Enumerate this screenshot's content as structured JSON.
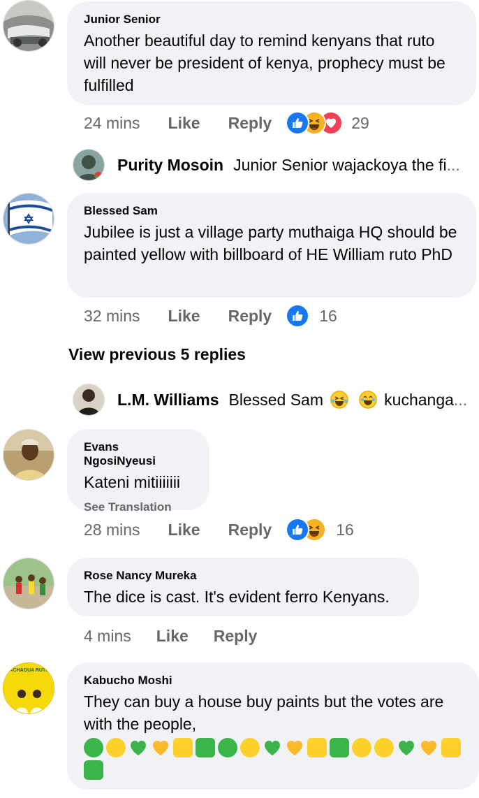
{
  "comments": [
    {
      "author": "Junior Senior",
      "text": "Another beautiful day to remind kenyans that ruto will never be president of kenya, prophecy must be fulfilled",
      "time": "24 mins",
      "like": "Like",
      "reply": "Reply",
      "reactions": [
        "like-icon",
        "haha-icon",
        "love-icon"
      ],
      "reaction_count": "29"
    },
    {
      "author": "Blessed Sam",
      "text": "Jubilee is just a village party muthaiga HQ should be painted yellow with billboard of HE William ruto PhD",
      "time": "32 mins",
      "like": "Like",
      "reply": "Reply",
      "reactions": [
        "like-icon"
      ],
      "reaction_count": "16"
    },
    {
      "author": "Evans NgosiNyeusi",
      "text": "Kateni mitiiiiiii",
      "see_translation": "See Translation",
      "time": "28 mins",
      "like": "Like",
      "reply": "Reply",
      "reactions": [
        "like-icon",
        "haha-icon"
      ],
      "reaction_count": "16"
    },
    {
      "author": "Rose Nancy Mureka",
      "text": "The dice is cast. It's evident ferro Kenyans.",
      "time": "4 mins",
      "like": "Like",
      "reply": "Reply"
    },
    {
      "author": "Kabucho Moshi",
      "text": "They can buy a house buy paints but the votes are with the people,",
      "emoji_sequence": [
        "green-circle",
        "yellow-circle",
        "green-heart",
        "yellow-heart",
        "yellow-square",
        "green-square",
        "green-circle",
        "yellow-circle",
        "green-heart",
        "yellow-heart",
        "yellow-square",
        "green-square",
        "yellow-circle",
        "yellow-circle",
        "green-heart",
        "yellow-heart",
        "yellow-square",
        "green-square"
      ]
    }
  ],
  "replies": [
    {
      "name": "Purity Mosoin",
      "text": "Junior Senior wajackoya the fi",
      "ellipsis": "..."
    },
    {
      "name": "L.M. Williams",
      "text_before": "Blessed Sam",
      "emojis": [
        "rofl-emoji",
        "joy-emoji"
      ],
      "text_after": "kuchanga",
      "ellipsis": "..."
    }
  ],
  "view_previous": "View previous 5 replies",
  "avatars": {
    "kabucho_badge": "ACHAGUA RUTO"
  },
  "colors": {
    "bubble": "#f0f2f5",
    "meta_text": "#65676b",
    "like_blue": "#1877f2",
    "love_red": "#f33e58",
    "haha_yellow": "#f7b125"
  }
}
